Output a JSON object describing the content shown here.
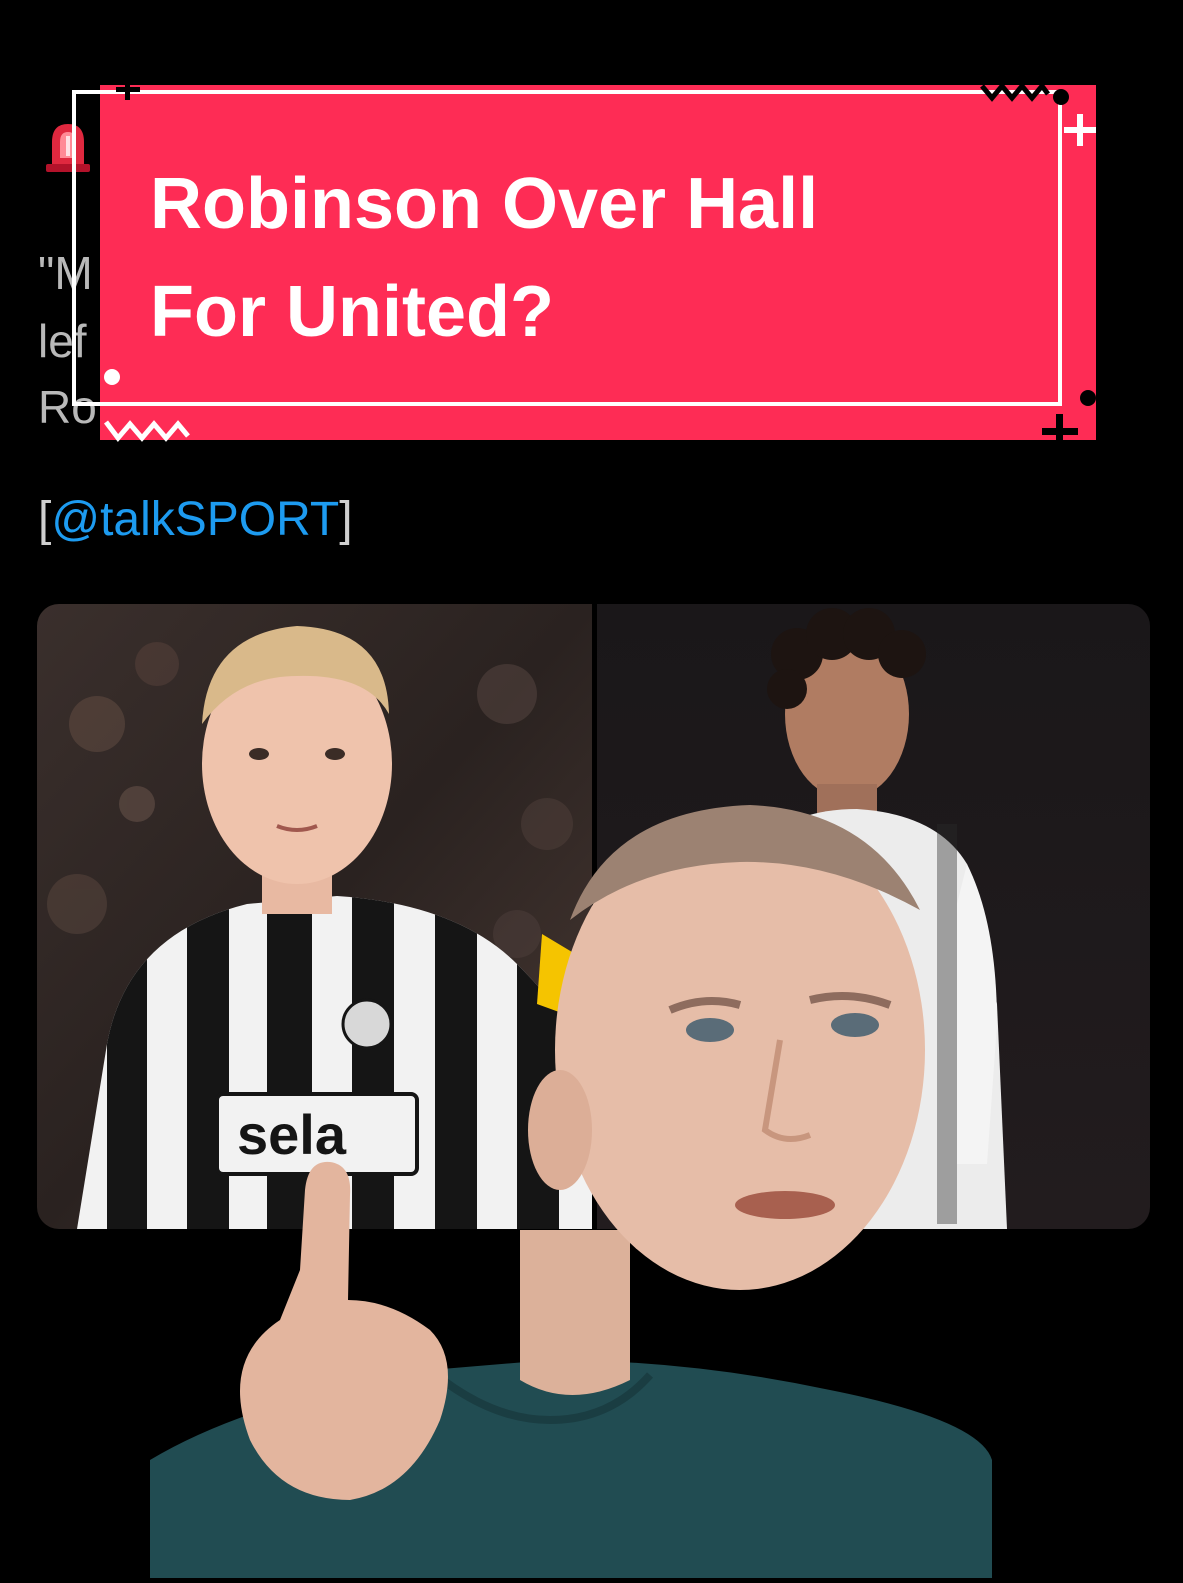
{
  "tweet": {
    "siren_icon": "rotating-light-icon",
    "line_1": "\"M",
    "line_2": "lef",
    "line_3": "Ro",
    "handle_open": "[",
    "handle_mention": "@talkSPORT",
    "handle_close": "]",
    "mention_color": "#1d9bf0"
  },
  "caption": {
    "line_1": "Robinson Over Hall",
    "line_2": "For United?",
    "background_color": "#fe2c55"
  },
  "images": {
    "left": {
      "subject": "player-newcastle-kit",
      "shirt_text": "sela"
    },
    "right": {
      "subject": "player-white-kit"
    }
  },
  "presenter": {
    "subject": "presenter-pointing-cutout"
  }
}
